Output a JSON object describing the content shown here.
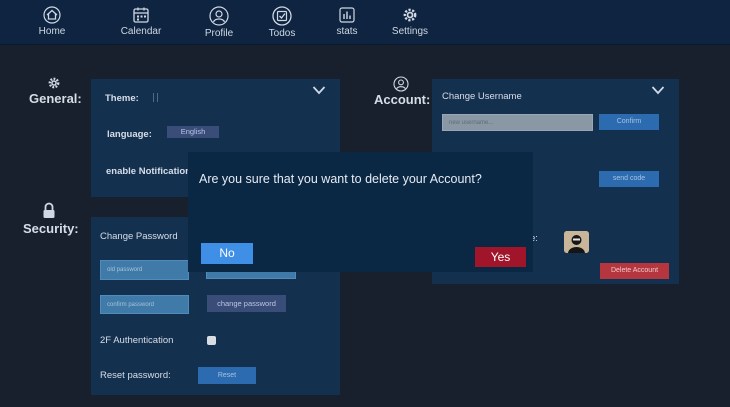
{
  "nav": {
    "items": [
      {
        "label": "Home",
        "icon": "home-icon"
      },
      {
        "label": "Calendar",
        "icon": "calendar-icon"
      },
      {
        "label": "Profile",
        "icon": "profile-icon"
      },
      {
        "label": "Todos",
        "icon": "todos-icon"
      },
      {
        "label": "stats",
        "icon": "stats-icon"
      },
      {
        "label": "Settings",
        "icon": "gear-icon"
      }
    ]
  },
  "general": {
    "title": "General:",
    "theme_label": "Theme:",
    "language_label": "language:",
    "language_value": "English",
    "notifications_label": "enable Notifications"
  },
  "account": {
    "title": "Account:",
    "change_username_label": "Change Username",
    "username_placeholder": "new username...",
    "confirm_label": "Confirm",
    "send_code_label": "send code",
    "avatar_label_partial": "e:",
    "delete_account_label": "Delete Account"
  },
  "security": {
    "title": "Security:",
    "change_password_label": "Change Password",
    "old_password_placeholder": "old password",
    "confirm_password_placeholder": "confirm password",
    "change_password_button": "change password",
    "twofa_label": "2F Authentication",
    "reset_label": "Reset password:",
    "reset_button": "Reset"
  },
  "modal": {
    "question": "Are you sure that you want to delete your Account?",
    "no_label": "No",
    "yes_label": "Yes"
  },
  "colors": {
    "nav_bg": "#0f2440",
    "panel_bg": "#14304f",
    "modal_bg": "#0a2744",
    "no_button": "#3f8fe6",
    "yes_button": "#a0152a",
    "delete_button": "#b5363f"
  }
}
